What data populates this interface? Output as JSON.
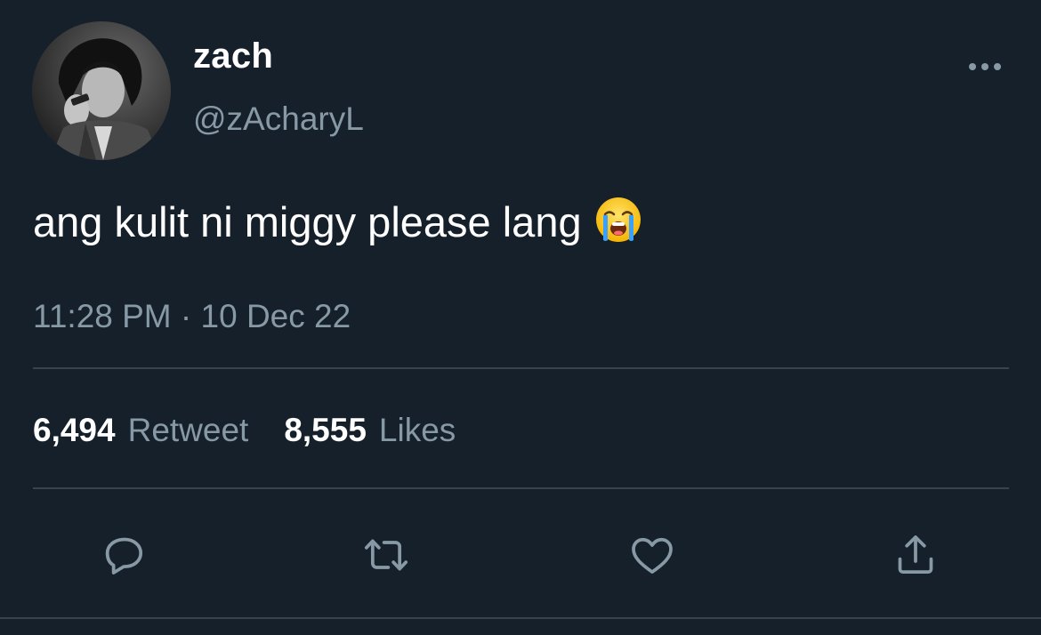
{
  "user": {
    "display_name": "zach",
    "handle": "@zAcharyL",
    "avatar_icon": "profile-photo"
  },
  "tweet": {
    "text": "ang kulit ni miggy please lang",
    "emoji": "loudly-crying-face",
    "time": "11:28 PM",
    "separator": "·",
    "date": "10 Dec 22"
  },
  "stats": {
    "retweets_count": "6,494",
    "retweets_label": "Retweet",
    "likes_count": "8,555",
    "likes_label": "Likes"
  },
  "actions": {
    "reply_icon": "reply-icon",
    "retweet_icon": "retweet-icon",
    "like_icon": "heart-icon",
    "share_icon": "share-icon",
    "more_icon": "more-icon"
  },
  "colors": {
    "background": "#15202b",
    "primary_text": "#ffffff",
    "secondary_text": "#8899a6",
    "divider": "#38444d"
  }
}
